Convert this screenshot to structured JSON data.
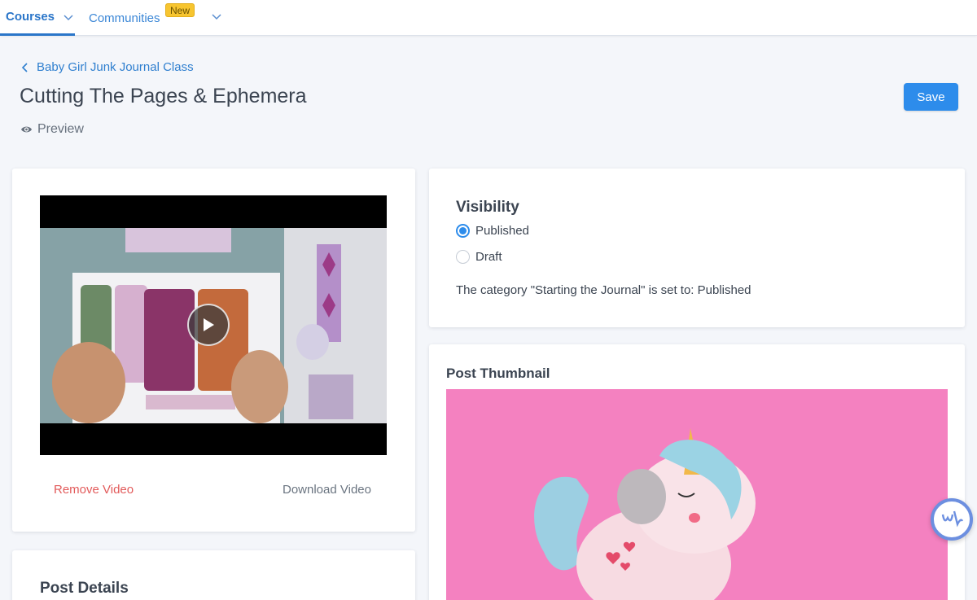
{
  "nav": {
    "courses_label": "Courses",
    "communities_label": "Communities",
    "new_badge": "New"
  },
  "header": {
    "breadcrumb": "Baby Girl Junk Journal Class",
    "title": "Cutting The Pages & Ephemera",
    "preview_label": "Preview",
    "save_label": "Save"
  },
  "video": {
    "remove_label": "Remove Video",
    "download_label": "Download Video"
  },
  "details": {
    "title": "Post Details"
  },
  "visibility": {
    "title": "Visibility",
    "options": [
      {
        "label": "Published",
        "checked": true
      },
      {
        "label": "Draft",
        "checked": false
      }
    ],
    "note": "The category \"Starting the Journal\" is set to: Published"
  },
  "thumbnail": {
    "title": "Post Thumbnail"
  },
  "colors": {
    "accent": "#2d8ceb",
    "danger": "#e25a5a",
    "badge": "#f7c530",
    "thumbnail_bg": "#f27fbf"
  }
}
